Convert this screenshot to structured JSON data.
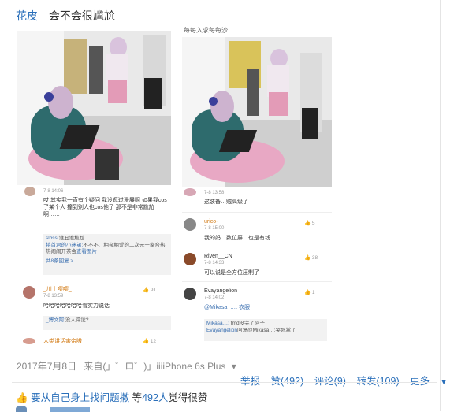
{
  "post": {
    "author": "花皮",
    "title": "会不会很尴尬"
  },
  "image_right": {
    "overlay_text": "每每入求每每沙"
  },
  "comments_left": [
    {
      "name": "",
      "time": "7-8 14:06",
      "text": "哎 其实我一直有个疑问 我没逛过漫展啊 如果我cos了某个人 撞到别人也cos他了 那不是非常尴尬啊……"
    },
    {
      "reply_user": "slbss:",
      "reply_text": "谁丑谁尴尬",
      "reply2_user": "将首君的小迷弟:",
      "reply2_text": "不不不、相亲相爱的二次元一家合热热闹闹开茶会",
      "reply2_tail": "查看图片",
      "more": "共8条回复 >"
    },
    {
      "name": "_川上嘤嘤_",
      "time": "7-8 13:59",
      "likes": "91",
      "text": "哈哈哈哈哈哈哈看实力说话"
    },
    {
      "reply_user": "_博文阿:",
      "reply_text": "没人评论?"
    },
    {
      "name": "人类讲话害帝嗷",
      "likes": "12"
    }
  ],
  "comments_right": [
    {
      "time": "7-8 13:58",
      "text": "这装备…贼高级了"
    },
    {
      "name": "urico-",
      "time": "7-8 15:00",
      "likes": "5",
      "text": "我的妈…数位屏…也是有钱"
    },
    {
      "name": "Riven__CN",
      "time": "7-8 14:33",
      "likes": "38",
      "text": "可以说是全方位压制了"
    },
    {
      "name": "Evayangelion",
      "time": "7-8 14:02",
      "likes": "1",
      "text": "@Mikasa_…: 衣服"
    },
    {
      "reply_user": "Mikasa…:",
      "reply_text": "tmd没完了阿子",
      "reply2_user": "Evayangelion",
      "reply2_text": "回复@Mikasa…:哭死掌了"
    }
  ],
  "meta": {
    "date": "2017年7月8日",
    "source": "来自(」゜ロ゜)」iiiiPhone 6s Plus",
    "dropdown_arrow": "▾"
  },
  "actions": {
    "report": "举报",
    "like": "赞(492)",
    "comment": "评论(9)",
    "forward": "转发(109)",
    "more": "更多"
  },
  "likebar": {
    "prefix": "要从自己身上找问题撒",
    "middle": " 等",
    "count": "492人",
    "suffix": "觉得很赞"
  },
  "colors": {
    "link": "#2a6fba",
    "name_orange": "#d27a14",
    "hair_pink": "#cdb3cf",
    "chair_pink": "#e8a8c4",
    "jacket_teal": "#2e6b6d"
  }
}
